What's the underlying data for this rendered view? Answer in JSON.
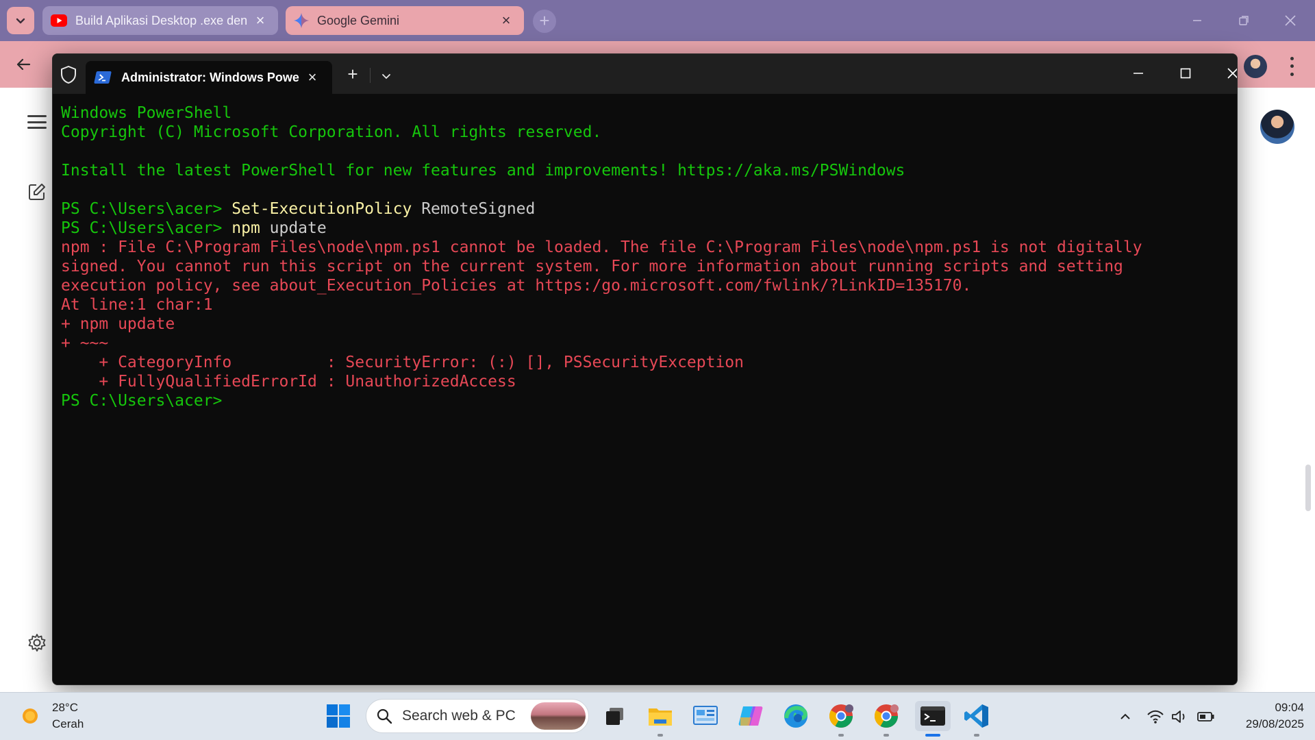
{
  "browser": {
    "tabs": [
      {
        "label": "Build Aplikasi Desktop .exe den",
        "icon": "youtube-icon",
        "active": false
      },
      {
        "label": "Google Gemini",
        "icon": "gemini-icon",
        "active": true
      }
    ],
    "accent_color": "#e9a6ad",
    "tabstrip_color": "#7a6fa3"
  },
  "terminal": {
    "tab_title": "Administrator: Windows Powe",
    "lines": [
      {
        "segments": [
          {
            "text": "Windows PowerShell",
            "color": "green"
          }
        ]
      },
      {
        "segments": [
          {
            "text": "Copyright (C) Microsoft Corporation. All rights reserved.",
            "color": "green"
          }
        ]
      },
      {
        "segments": []
      },
      {
        "segments": [
          {
            "text": "Install the latest PowerShell for new features and improvements! https://aka.ms/PSWindows",
            "color": "green"
          }
        ]
      },
      {
        "segments": []
      },
      {
        "segments": [
          {
            "text": "PS C:\\Users\\acer> ",
            "color": "green"
          },
          {
            "text": "Set-ExecutionPolicy",
            "color": "yellow"
          },
          {
            "text": " RemoteSigned",
            "color": "white"
          }
        ]
      },
      {
        "segments": [
          {
            "text": "PS C:\\Users\\acer> ",
            "color": "green"
          },
          {
            "text": "npm",
            "color": "yellow"
          },
          {
            "text": " update",
            "color": "white"
          }
        ]
      },
      {
        "segments": [
          {
            "text": "npm : File C:\\Program Files\\node\\npm.ps1 cannot be loaded. The file C:\\Program Files\\node\\npm.ps1 is not digitally",
            "color": "red"
          }
        ]
      },
      {
        "segments": [
          {
            "text": "signed. You cannot run this script on the current system. For more information about running scripts and setting",
            "color": "red"
          }
        ]
      },
      {
        "segments": [
          {
            "text": "execution policy, see about_Execution_Policies at https:/go.microsoft.com/fwlink/?LinkID=135170.",
            "color": "red"
          }
        ]
      },
      {
        "segments": [
          {
            "text": "At line:1 char:1",
            "color": "red"
          }
        ]
      },
      {
        "segments": [
          {
            "text": "+ npm update",
            "color": "red"
          }
        ]
      },
      {
        "segments": [
          {
            "text": "+ ~~~",
            "color": "red"
          }
        ]
      },
      {
        "segments": [
          {
            "text": "    + CategoryInfo          : SecurityError: (:) [], PSSecurityException",
            "color": "red"
          }
        ]
      },
      {
        "segments": [
          {
            "text": "    + FullyQualifiedErrorId : UnauthorizedAccess",
            "color": "red"
          }
        ]
      },
      {
        "segments": [
          {
            "text": "PS C:\\Users\\acer>",
            "color": "green"
          }
        ]
      }
    ],
    "colors": {
      "green": "#16c60c",
      "red": "#e74856",
      "yellow": "#f9f1a5",
      "white": "#cccccc",
      "background": "#0c0c0c"
    }
  },
  "taskbar": {
    "weather_temp": "28°C",
    "weather_desc": "Cerah",
    "search_placeholder": "Search web & PC",
    "apps": [
      "windows-start-icon",
      "task-view-icon",
      "file-explorer-icon",
      "control-panel-icon",
      "copilot-icon",
      "edge-icon",
      "chrome-profile-1-icon",
      "chrome-profile-2-icon",
      "terminal-icon",
      "vscode-icon"
    ],
    "time": "09:04",
    "date": "29/08/2025"
  }
}
